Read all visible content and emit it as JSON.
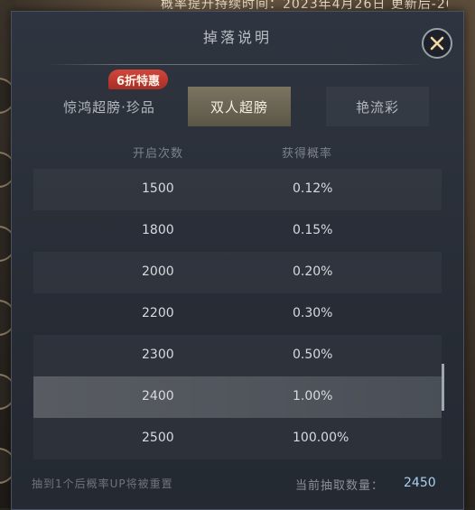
{
  "background": {
    "ticker_text": "概率提升持续时间：2023年4月26日 更新后-20"
  },
  "dialog": {
    "title": "掉落说明",
    "close_icon": "close-icon"
  },
  "tabs": [
    {
      "label": "惊鸿超膀·珍品",
      "selected": false
    },
    {
      "label": "双人超膀",
      "selected": true
    },
    {
      "label": "艳流彩",
      "selected": false
    }
  ],
  "badge": {
    "label": "6折特惠",
    "color": "#c0392b"
  },
  "table": {
    "headers": {
      "count": "开启次数",
      "prob": "获得概率"
    },
    "rows": [
      {
        "count": "1500",
        "prob": "0.12%"
      },
      {
        "count": "1800",
        "prob": "0.15%"
      },
      {
        "count": "2000",
        "prob": "0.20%"
      },
      {
        "count": "2200",
        "prob": "0.30%"
      },
      {
        "count": "2300",
        "prob": "0.50%"
      },
      {
        "count": "2400",
        "prob": "1.00%"
      },
      {
        "count": "2500",
        "prob": "100.00%"
      }
    ],
    "selected_row_index": 5
  },
  "footer": {
    "note": "抽到1个后概率UP将被重置",
    "current_label": "当前抽取数量：",
    "current_value": "2450"
  },
  "colors": {
    "accent_value": "#a9d1ef",
    "selected_tab": "#6f6a57"
  }
}
